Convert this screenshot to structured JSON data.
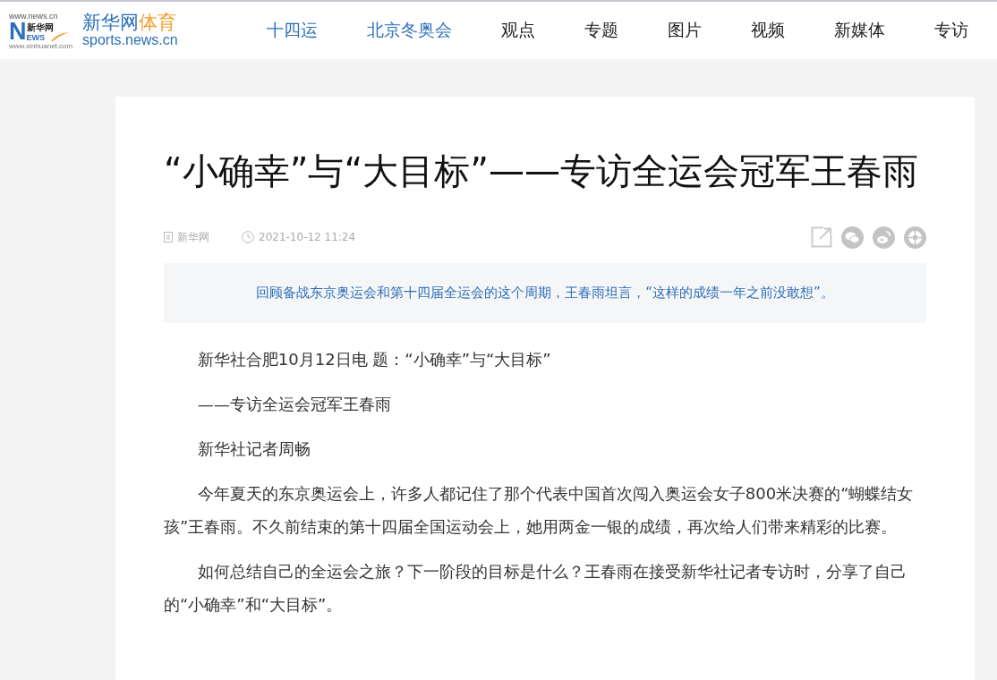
{
  "logo": {
    "url_top": "www.news.cn",
    "mark_letter": "N",
    "mark_cn": "新华网",
    "mark_rest": "EWS",
    "url_bottom": "www.xinhuanet.com",
    "name": "新华网",
    "channel": "体育",
    "domain": "sports.news.cn"
  },
  "nav": [
    {
      "label": "十四运",
      "highlighted": true
    },
    {
      "label": "北京冬奥会",
      "highlighted": true
    },
    {
      "label": "观点",
      "highlighted": false
    },
    {
      "label": "专题",
      "highlighted": false
    },
    {
      "label": "图片",
      "highlighted": false
    },
    {
      "label": "视频",
      "highlighted": false
    },
    {
      "label": "新媒体",
      "highlighted": false
    },
    {
      "label": "专访",
      "highlighted": false
    }
  ],
  "article": {
    "title": "“小确幸”与“大目标”——专访全运会冠军王春雨",
    "source": "新华网",
    "time": "2021-10-12 11:24",
    "share": [
      {
        "kind": "link"
      },
      {
        "kind": "wechat"
      },
      {
        "kind": "weibo"
      },
      {
        "kind": "moments"
      }
    ],
    "summary": "回顾备战东京奥运会和第十四届全运会的这个周期，王春雨坦言，“这样的成绩一年之前没敢想”。",
    "paragraphs": [
      "新华社合肥10月12日电 题：“小确幸”与“大目标”",
      "——专访全运会冠军王春雨",
      "新华社记者周畅",
      "今年夏天的东京奥运会上，许多人都记住了那个代表中国首次闯入奥运会女子800米决赛的“蝴蝶结女孩”王春雨。不久前结束的第十四届全国运动会上，她用两金一银的成绩，再次给人们带来精彩的比赛。",
      "如何总结自己的全运会之旅？下一阶段的目标是什么？王春雨在接受新华社记者专访时，分享了自己的“小确幸”和“大目标”。"
    ]
  }
}
